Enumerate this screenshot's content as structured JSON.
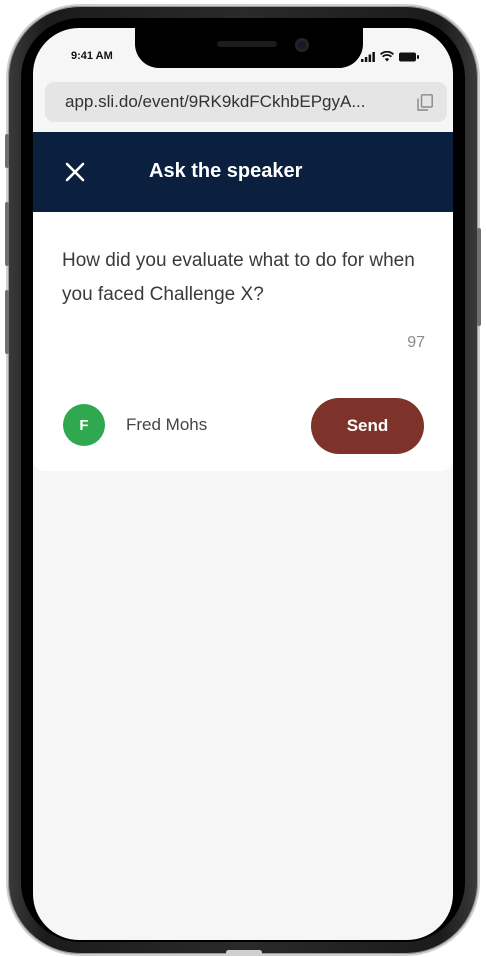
{
  "status_bar": {
    "time": "9:41 AM"
  },
  "browser": {
    "url": "app.sli.do/event/9RK9kdFCkhbEPgyA..."
  },
  "header": {
    "title": "Ask the speaker",
    "close_icon": "close-icon"
  },
  "question": {
    "text": "How did you evaluate what to do for when you faced Challenge X?",
    "char_count": "97"
  },
  "author": {
    "initial": "F",
    "name": "Fred Mohs"
  },
  "actions": {
    "send_label": "Send"
  },
  "colors": {
    "header_bg": "#0b1f3f",
    "send_bg": "#7d3329",
    "avatar_bg": "#2fa84f"
  }
}
